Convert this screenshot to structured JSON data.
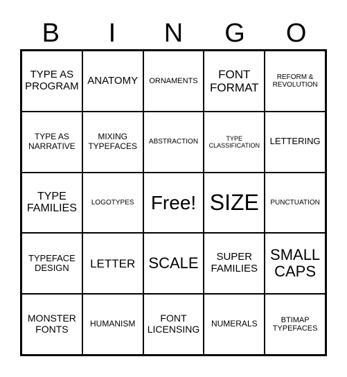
{
  "header": [
    "B",
    "I",
    "N",
    "G",
    "O"
  ],
  "cells": [
    "TYPE AS\nPROGRAM",
    "ANATOMY",
    "ORNAMENTS",
    "FONT\nFORMAT",
    "REFORM &\nREVOLUTION",
    "TYPE AS\nNARRATIVE",
    "MIXING\nTYPEFACES",
    "ABSTRACTION",
    "TYPE\nCLASSIFICATION",
    "LETTERING",
    "TYPE\nFAMILIES",
    "LOGOTYPES",
    "Free!",
    "SIZE",
    "PUNCTUATION",
    "TYPEFACE\nDESIGN",
    "LETTER",
    "SCALE",
    "SUPER\nFAMILIES",
    "SMALL\nCAPS",
    "MONSTER\nFONTS",
    "HUMANISM",
    "FONT\nLICENSING",
    "NUMERALS",
    "BTIMAP\nTYPEFACES"
  ]
}
